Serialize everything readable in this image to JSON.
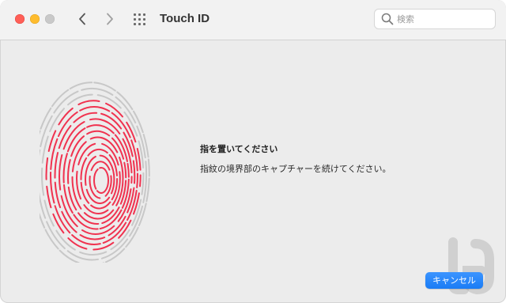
{
  "window": {
    "title": "Touch ID",
    "traffic_lights": {
      "close": "#ff5f57",
      "minimize": "#febc2e",
      "zoom": "#c9c9c9"
    }
  },
  "toolbar": {
    "back_icon": "chevron-left-icon",
    "forward_icon": "chevron-right-icon",
    "show_all_icon": "grid-icon"
  },
  "search": {
    "placeholder": "検索",
    "value": ""
  },
  "main": {
    "illustration": "fingerprint-icon",
    "heading": "指を置いてください",
    "instruction": "指紋の境界部のキャプチャーを続けてください。",
    "cancel_label": "キャンセル"
  },
  "colors": {
    "fingerprint_captured": "#f0324f",
    "fingerprint_pending": "#c8c8c8",
    "accent": "#1a7cf5"
  }
}
